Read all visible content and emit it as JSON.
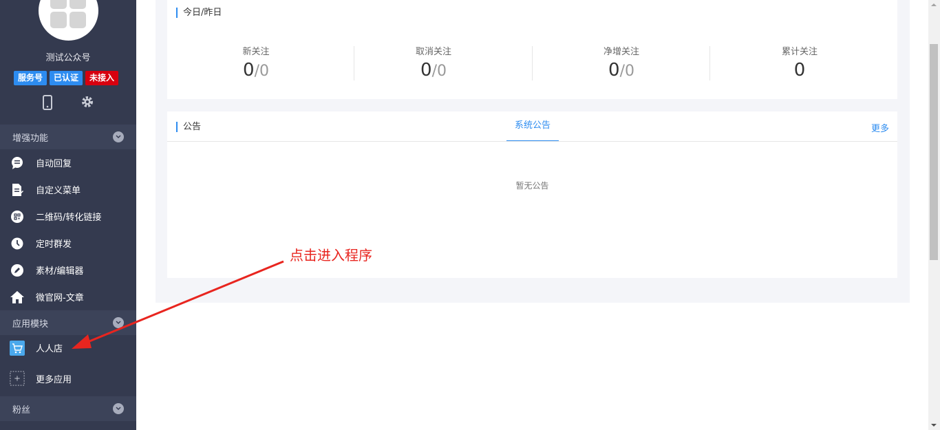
{
  "account": {
    "name": "测试公众号",
    "badges": [
      "服务号",
      "已认证",
      "未接入"
    ]
  },
  "sidebar": {
    "enhanced": {
      "title": "增强功能",
      "items": [
        {
          "label": "自动回复",
          "icon": "chat-bubble-icon"
        },
        {
          "label": "自定义菜单",
          "icon": "edit-document-icon"
        },
        {
          "label": "二维码/转化链接",
          "icon": "qrcode-icon"
        },
        {
          "label": "定时群发",
          "icon": "clock-icon"
        },
        {
          "label": "素材/编辑器",
          "icon": "pencil-icon"
        },
        {
          "label": "微官网-文章",
          "icon": "home-icon"
        }
      ]
    },
    "modules": {
      "title": "应用模块",
      "items": [
        {
          "label": "人人店",
          "icon": "shopping-cart-icon"
        },
        {
          "label": "更多应用",
          "icon": "add-app-icon"
        }
      ]
    },
    "fans": {
      "title": "粉丝"
    }
  },
  "stats": {
    "title": "今日/昨日",
    "items": [
      {
        "label": "新关注",
        "today": "0",
        "yesterday": "0"
      },
      {
        "label": "取消关注",
        "today": "0",
        "yesterday": "0"
      },
      {
        "label": "净增关注",
        "today": "0",
        "yesterday": "0"
      },
      {
        "label": "累计关注",
        "today": "0"
      }
    ],
    "separator": "/"
  },
  "notice": {
    "title": "公告",
    "tab": "系统公告",
    "more": "更多",
    "empty": "暂无公告"
  },
  "annotation": {
    "text": "点击进入程序",
    "color": "#e8251f"
  },
  "colors": {
    "sidebar": "#343a4f",
    "accent": "#2d8cf0",
    "badge_red": "#d7000f"
  }
}
